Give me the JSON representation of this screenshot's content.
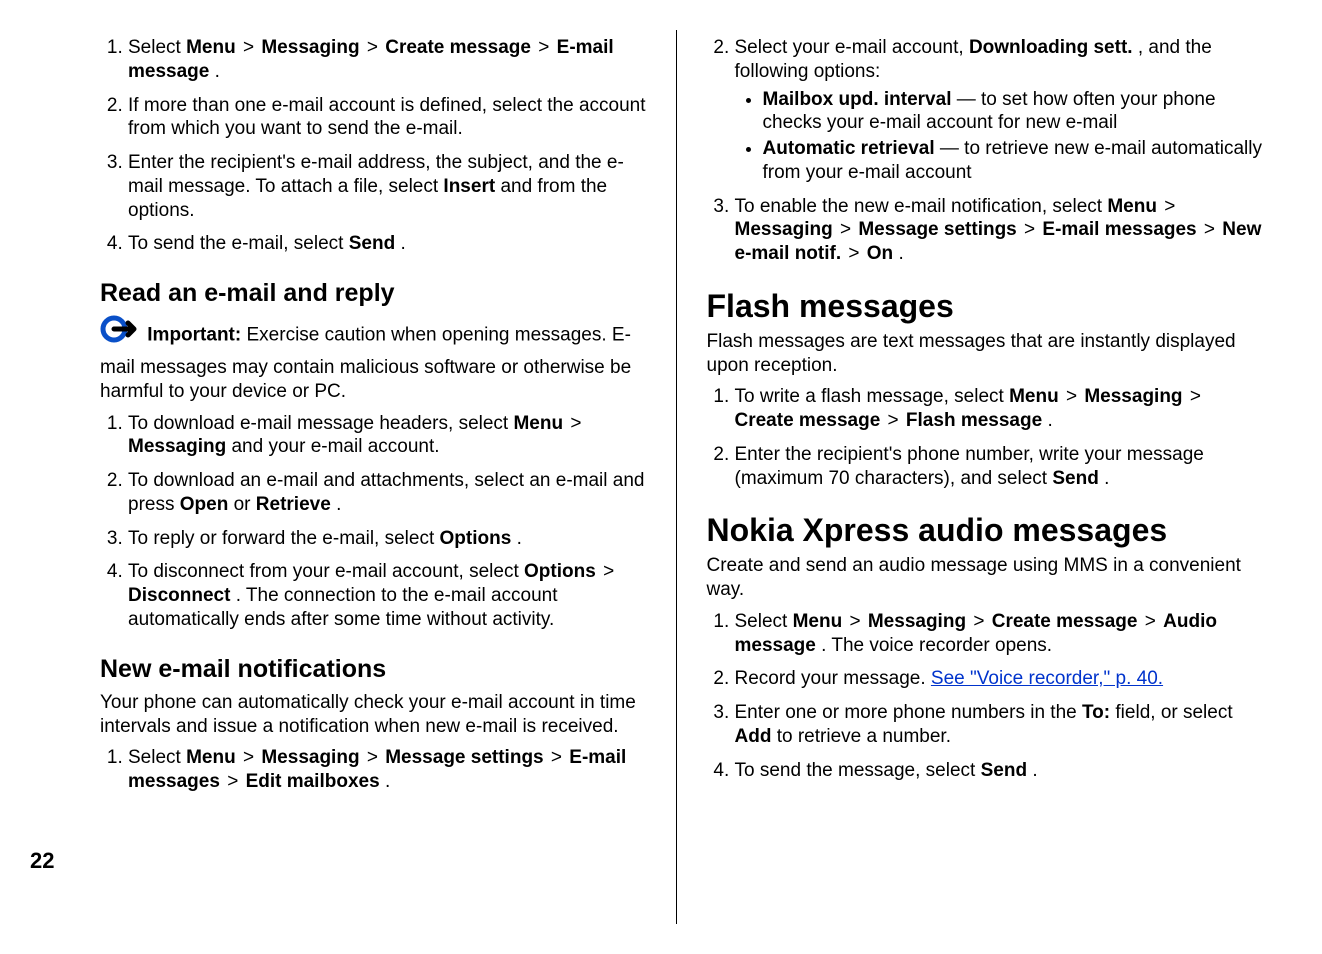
{
  "page_number": "22",
  "left": {
    "list1": {
      "i1": {
        "pre": "Select ",
        "b1": "Menu",
        "gt1": " > ",
        "b2": " Messaging",
        "gt2": " > ",
        "b3": " Create message",
        "gt3": " > ",
        "b4": "E-mail message",
        "post": "."
      },
      "i2": "If more than one e-mail account is defined, select the account from which you want to send the e-mail.",
      "i3": {
        "pre": "Enter the recipient's e-mail address, the subject, and the e-mail message. To attach a file, select ",
        "b1": "Insert",
        "post": " and from the options."
      },
      "i4": {
        "pre": "To send the e-mail, select ",
        "b1": "Send",
        "post": "."
      }
    },
    "h2a": "Read an e-mail and reply",
    "important": {
      "label": "Important: ",
      "text": "Exercise caution when opening messages. E-mail messages may contain malicious software or otherwise be harmful to your device or PC."
    },
    "list2": {
      "i1": {
        "pre": "To download e-mail message headers, select ",
        "b1": "Menu",
        "gt1": " > ",
        "b2": " Messaging",
        "post": " and your e-mail account."
      },
      "i2": {
        "pre": "To download an e-mail and attachments, select an e-mail and press ",
        "b1": "Open",
        "mid": " or ",
        "b2": "Retrieve",
        "post": "."
      },
      "i3": {
        "pre": "To reply or forward the e-mail, select ",
        "b1": "Options",
        "post": "."
      },
      "i4": {
        "pre": "To disconnect from your e-mail account, select ",
        "b1": "Options",
        "gt1": " > ",
        "b2": " Disconnect",
        "post": ". The connection to the e-mail account automatically ends after some time without activity."
      }
    },
    "h2b": "New e-mail notifications",
    "notif_intro": "Your phone can automatically check your e-mail account in time intervals and issue a notification when new e-mail is received.",
    "list3": {
      "i1": {
        "pre": "Select ",
        "b1": "Menu",
        "gt1": " > ",
        "b2": " Messaging",
        "gt2": " > ",
        "b3": " Message settings",
        "gt3": " > ",
        "b4": " E-mail messages",
        "gt4": " > ",
        "b5": " Edit mailboxes",
        "post": "."
      }
    }
  },
  "right": {
    "list2start": {
      "i2": {
        "pre": "Select your e-mail account, ",
        "b1": "Downloading sett.",
        "post": ", and the following options:"
      },
      "bul1": {
        "b1": "Mailbox upd. interval ",
        "post": " — to set how often your phone checks your e-mail account for new e-mail"
      },
      "bul2": {
        "b1": "Automatic retrieval ",
        "post": " — to retrieve new e-mail automatically from your e-mail account"
      },
      "i3": {
        "pre": "To enable the new e-mail notification, select ",
        "b1": "Menu",
        "gt1": " > ",
        "b2": " Messaging",
        "gt2": " > ",
        "b3": " Message settings",
        "gt3": " > ",
        "b4": " E-mail messages",
        "gt4": " > ",
        "b5": " New e-mail notif.",
        "gt5": " > ",
        "b6": " On",
        "post": "."
      }
    },
    "h1a": "Flash messages",
    "flash_intro": "Flash messages are text messages that are instantly displayed upon reception.",
    "flash_list": {
      "i1": {
        "pre": "To write a flash message, select ",
        "b1": "Menu",
        "gt1": " > ",
        "b2": "Messaging",
        "gt2": " > ",
        "b3": " Create message",
        "gt3": " > ",
        "b4": " Flash message",
        "post": "."
      },
      "i2": {
        "pre": "Enter the recipient's phone number, write your message (maximum 70 characters), and select ",
        "b1": "Send",
        "post": "."
      }
    },
    "h1b": "Nokia Xpress audio messages",
    "xpress_intro": "Create and send an audio message using MMS in a convenient way.",
    "xpress_list": {
      "i1": {
        "pre": "Select ",
        "b1": "Menu",
        "gt1": " > ",
        "b2": " Messaging",
        "gt2": " > ",
        "b3": " Create message",
        "gt3": " > ",
        "b4": "Audio message",
        "post": ". The voice recorder opens."
      },
      "i2": {
        "pre": "Record your message. ",
        "link": "See \"Voice recorder,\" p. 40."
      },
      "i3": {
        "pre": "Enter one or more phone numbers in the ",
        "b1": "To:",
        "mid": " field, or select ",
        "b2": "Add",
        "post": " to retrieve a number."
      },
      "i4": {
        "pre": "To send the message, select ",
        "b1": "Send",
        "post": "."
      }
    }
  }
}
